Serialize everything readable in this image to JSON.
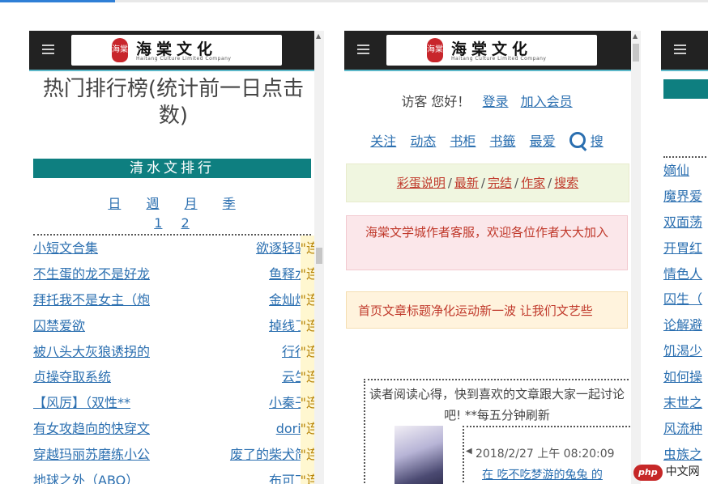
{
  "header": {
    "logo_seal_text": "海棠",
    "logo_name": "海棠文化",
    "logo_en": "Haitang Culture Limited Company"
  },
  "ranking_page": {
    "title": "热门排行榜(统计前一日点击数)",
    "band_title": "清水文排行",
    "periods": [
      "日",
      "週",
      "月",
      "季"
    ],
    "pages": [
      "1",
      "2"
    ],
    "rows": [
      {
        "title": "小短文合集",
        "author": "欲逐轻骑",
        "status": "\"连载"
      },
      {
        "title": "不生蛋的龙不是好龙",
        "author": "鱼释水",
        "status": "\"连载"
      },
      {
        "title": "拜托我不是女主（炮",
        "author": "金灿灿",
        "status": "\"连载"
      },
      {
        "title": "囚禁爱欲",
        "author": "掉线了",
        "status": "\"连载"
      },
      {
        "title": "被八头大灰狼诱拐的",
        "author": "行行",
        "status": "\"连载"
      },
      {
        "title": "贞操夺取系统",
        "author": "云生",
        "status": "\"连载"
      },
      {
        "title": "【风厉】（双性**",
        "author": "小秦子",
        "status": "\"连载"
      },
      {
        "title": "有女攻趋向的快穿文",
        "author": "doris",
        "status": "\"连载"
      },
      {
        "title": "穿越玛丽苏磨练小公",
        "author": "废了的柴犬简",
        "status": "\"连载"
      },
      {
        "title": "地球之外（ABO）",
        "author": "布可丁",
        "status": "\"连载"
      }
    ]
  },
  "home_page": {
    "greeting": "访客 您好！",
    "login": "登录",
    "join": "加入会员",
    "nav": [
      "关注",
      "动态",
      "书柜",
      "书籤",
      "最爱"
    ],
    "search_label": "搜",
    "box1_links": [
      "彩蛋说明",
      "最新",
      "完结",
      "作家",
      "搜索"
    ],
    "box1_sep": "/",
    "box2_text": "海棠文学城作者客服，欢迎各位作者大大加入",
    "box3_text": "首页文章标题净化运动新一波 让我们文艺些",
    "reader_text": "读者阅读心得，快到喜欢的文章跟大家一起讨论吧! **每五分钟刷新",
    "post_time": "2018/2/27 上午 08:20:09",
    "post_snippet": "在 吃不吃梦游的兔兔 的"
  },
  "third_page": {
    "rows": [
      "嫡仙",
      "魔界爱",
      "双面荡",
      "开胃红",
      "情色人",
      "囚生（",
      "论解避",
      "饥渴少",
      "如何操",
      "末世之",
      "风流种",
      "虫族之"
    ]
  },
  "watermark": {
    "brand": "php",
    "site": "中文网"
  },
  "colors": {
    "accent_teal": "#0e7f80",
    "link_blue": "#2b6fb0",
    "header_dark": "#222222",
    "tab_blue": "#2f7fd6"
  }
}
